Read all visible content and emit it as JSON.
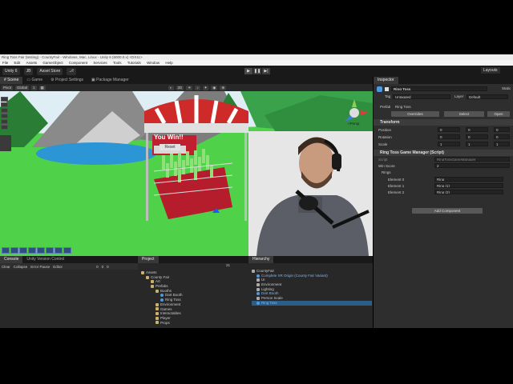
{
  "window": {
    "title": "Ring Toss Fair (testing) - CountyFair - Windows, Mac, Linux - Unity 6 (6000.0.x) <DX11>"
  },
  "menu": [
    "File",
    "Edit",
    "Assets",
    "GameObject",
    "Component",
    "Services",
    "Tools",
    "Tutorials",
    "Window",
    "Help"
  ],
  "toolbar": {
    "unity_btn": "Unity 6",
    "account_btn": "JB",
    "asset_store_btn": "Asset Store",
    "play_icon": "▶",
    "pause_icon": "❚❚",
    "step_icon": "▶|",
    "right_btn": "Layouts"
  },
  "scene_tabs": [
    {
      "label": "Scene",
      "icon": "#"
    },
    {
      "label": "Game",
      "icon": "▭"
    },
    {
      "label": "Project Settings",
      "icon": "⚙"
    },
    {
      "label": "Package Manager",
      "icon": "▣"
    }
  ],
  "scene_tools": {
    "pivot": "Pivot",
    "space": "Global",
    "snap": "1",
    "persp_label": "<Persp"
  },
  "booth": {
    "sign": "You Win!!",
    "button": "Reset"
  },
  "inspector": {
    "tab": "Inspector",
    "object_name": "Ring Toss",
    "static_label": "Static",
    "tag_label": "Tag",
    "tag_value": "Untagged",
    "layer_label": "Layer",
    "layer_value": "Default",
    "prefab_label": "Prefab",
    "prefab_value": "Ring Toss",
    "overrides_btn": "Overrides",
    "select_btn": "Select",
    "open_btn": "Open",
    "transform": {
      "title": "Transform",
      "rows": [
        {
          "label": "Position",
          "x": "0",
          "y": "0",
          "z": "0"
        },
        {
          "label": "Rotation",
          "x": "0",
          "y": "0",
          "z": "0"
        },
        {
          "label": "Scale",
          "x": "1",
          "y": "1",
          "z": "1"
        }
      ]
    },
    "script_comp": {
      "title": "Ring Toss Game Manager (Script)",
      "script_label": "Script",
      "script_value": "RingTossGameManager",
      "win_label": "Win Score",
      "win_value": "2",
      "rings_label": "Rings",
      "elements": [
        {
          "label": "Element 0",
          "value": "Ring"
        },
        {
          "label": "Element 1",
          "value": "Ring (1)"
        },
        {
          "label": "Element 2",
          "value": "Ring (2)"
        }
      ]
    },
    "add_component": "Add Component"
  },
  "console": {
    "tab": "Console",
    "tab2": "Unity Version Control",
    "clear": "Clear",
    "collapse": "Collapse",
    "error_pause": "Error Pause",
    "editor": "Editor",
    "count0": "0",
    "count1": "0",
    "count2": "0"
  },
  "project": {
    "tab": "Project",
    "count": "21",
    "tree": [
      {
        "label": "Assets",
        "level": 0,
        "icon": "folder"
      },
      {
        "label": "County Fair",
        "level": 1,
        "icon": "folder"
      },
      {
        "label": "Art",
        "level": 2,
        "icon": "folder"
      },
      {
        "label": "Prefabs",
        "level": 2,
        "icon": "folder"
      },
      {
        "label": "Booths",
        "level": 3,
        "icon": "folder"
      },
      {
        "label": "Dart Booth",
        "level": 4,
        "icon": "prefab"
      },
      {
        "label": "Ring Toss",
        "level": 4,
        "icon": "prefab"
      },
      {
        "label": "Environment",
        "level": 3,
        "icon": "folder"
      },
      {
        "label": "Games",
        "level": 3,
        "icon": "folder"
      },
      {
        "label": "Interactables",
        "level": 3,
        "icon": "folder"
      },
      {
        "label": "Player",
        "level": 3,
        "icon": "folder"
      },
      {
        "label": "Props",
        "level": 3,
        "icon": "folder"
      }
    ]
  },
  "hierarchy": {
    "tab": "Hierarchy",
    "tree": [
      {
        "label": "CountyFair",
        "level": 0,
        "blue": false,
        "sel": false,
        "icon": "cube"
      },
      {
        "label": "Complete XR Origin (County Fair Variant)",
        "level": 1,
        "blue": true,
        "sel": false,
        "icon": "prefab"
      },
      {
        "label": "UI",
        "level": 1,
        "blue": false,
        "sel": false,
        "icon": "cube"
      },
      {
        "label": "Environment",
        "level": 1,
        "blue": false,
        "sel": false,
        "icon": "cube"
      },
      {
        "label": "Lighting",
        "level": 1,
        "blue": false,
        "sel": false,
        "icon": "cube"
      },
      {
        "label": "Dart Booth",
        "level": 1,
        "blue": true,
        "sel": false,
        "icon": "prefab"
      },
      {
        "label": "Person Scale",
        "level": 1,
        "blue": false,
        "sel": false,
        "icon": "cube"
      },
      {
        "label": "Ring Toss",
        "level": 1,
        "blue": true,
        "sel": true,
        "icon": "prefab"
      }
    ]
  }
}
